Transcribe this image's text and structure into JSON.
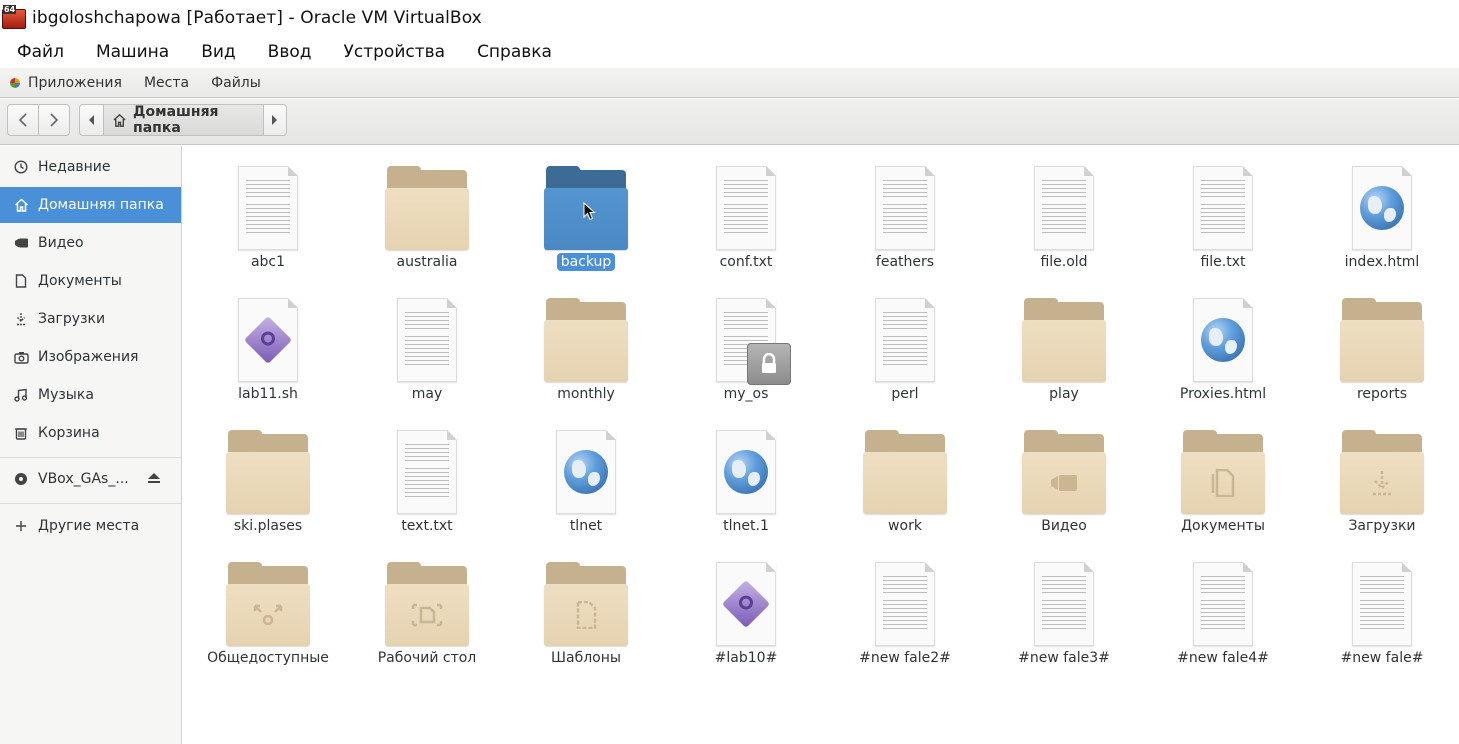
{
  "window": {
    "title": "ibgoloshchapowa [Работает] - Oracle VM VirtualBox",
    "icon_badge": "64"
  },
  "vbox_menu": [
    "Файл",
    "Машина",
    "Вид",
    "Ввод",
    "Устройства",
    "Справка"
  ],
  "panel": {
    "apps": "Приложения",
    "places": "Места",
    "files": "Файлы"
  },
  "pathbar": {
    "current": "Домашняя папка"
  },
  "sidebar": {
    "items": [
      {
        "label": "Недавние",
        "icon": "clock-icon"
      },
      {
        "label": "Домашняя папка",
        "icon": "home-icon"
      },
      {
        "label": "Видео",
        "icon": "video-icon"
      },
      {
        "label": "Документы",
        "icon": "document-icon"
      },
      {
        "label": "Загрузки",
        "icon": "download-icon"
      },
      {
        "label": "Изображения",
        "icon": "camera-icon"
      },
      {
        "label": "Музыка",
        "icon": "music-icon"
      },
      {
        "label": "Корзина",
        "icon": "trash-icon"
      }
    ],
    "device": {
      "label": "VBox_GAs_...",
      "icon": "disc-icon"
    },
    "other": {
      "label": "Другие места",
      "icon": "plus-icon"
    }
  },
  "files": [
    {
      "name": "abc1",
      "kind": "text"
    },
    {
      "name": "australia",
      "kind": "folder"
    },
    {
      "name": "backup",
      "kind": "folder-selected"
    },
    {
      "name": "conf.txt",
      "kind": "text"
    },
    {
      "name": "feathers",
      "kind": "text"
    },
    {
      "name": "file.old",
      "kind": "text"
    },
    {
      "name": "file.txt",
      "kind": "text"
    },
    {
      "name": "index.html",
      "kind": "html"
    },
    {
      "name": "lab11.sh",
      "kind": "script"
    },
    {
      "name": "may",
      "kind": "text"
    },
    {
      "name": "monthly",
      "kind": "folder"
    },
    {
      "name": "my_os",
      "kind": "text-locked"
    },
    {
      "name": "perl",
      "kind": "text"
    },
    {
      "name": "play",
      "kind": "folder"
    },
    {
      "name": "Proxies.html",
      "kind": "html"
    },
    {
      "name": "reports",
      "kind": "folder"
    },
    {
      "name": "ski.plases",
      "kind": "folder"
    },
    {
      "name": "text.txt",
      "kind": "text"
    },
    {
      "name": "tlnet",
      "kind": "html"
    },
    {
      "name": "tlnet.1",
      "kind": "html"
    },
    {
      "name": "work",
      "kind": "folder"
    },
    {
      "name": "Видео",
      "kind": "folder-video"
    },
    {
      "name": "Документы",
      "kind": "folder-documents"
    },
    {
      "name": "Загрузки",
      "kind": "folder-downloads"
    },
    {
      "name": "Общедоступные",
      "kind": "folder-share"
    },
    {
      "name": "Рабочий стол",
      "kind": "folder-desktop"
    },
    {
      "name": "Шаблоны",
      "kind": "folder-templates"
    },
    {
      "name": "#lab10#",
      "kind": "script"
    },
    {
      "name": "#new fale2#",
      "kind": "text"
    },
    {
      "name": "#new fale3#",
      "kind": "text"
    },
    {
      "name": "#new fale4#",
      "kind": "text"
    },
    {
      "name": "#new fale#",
      "kind": "text"
    }
  ],
  "colors": {
    "selection": "#4a90d9",
    "folder": "#e5d2b0",
    "folder_selected": "#4a88c2"
  }
}
